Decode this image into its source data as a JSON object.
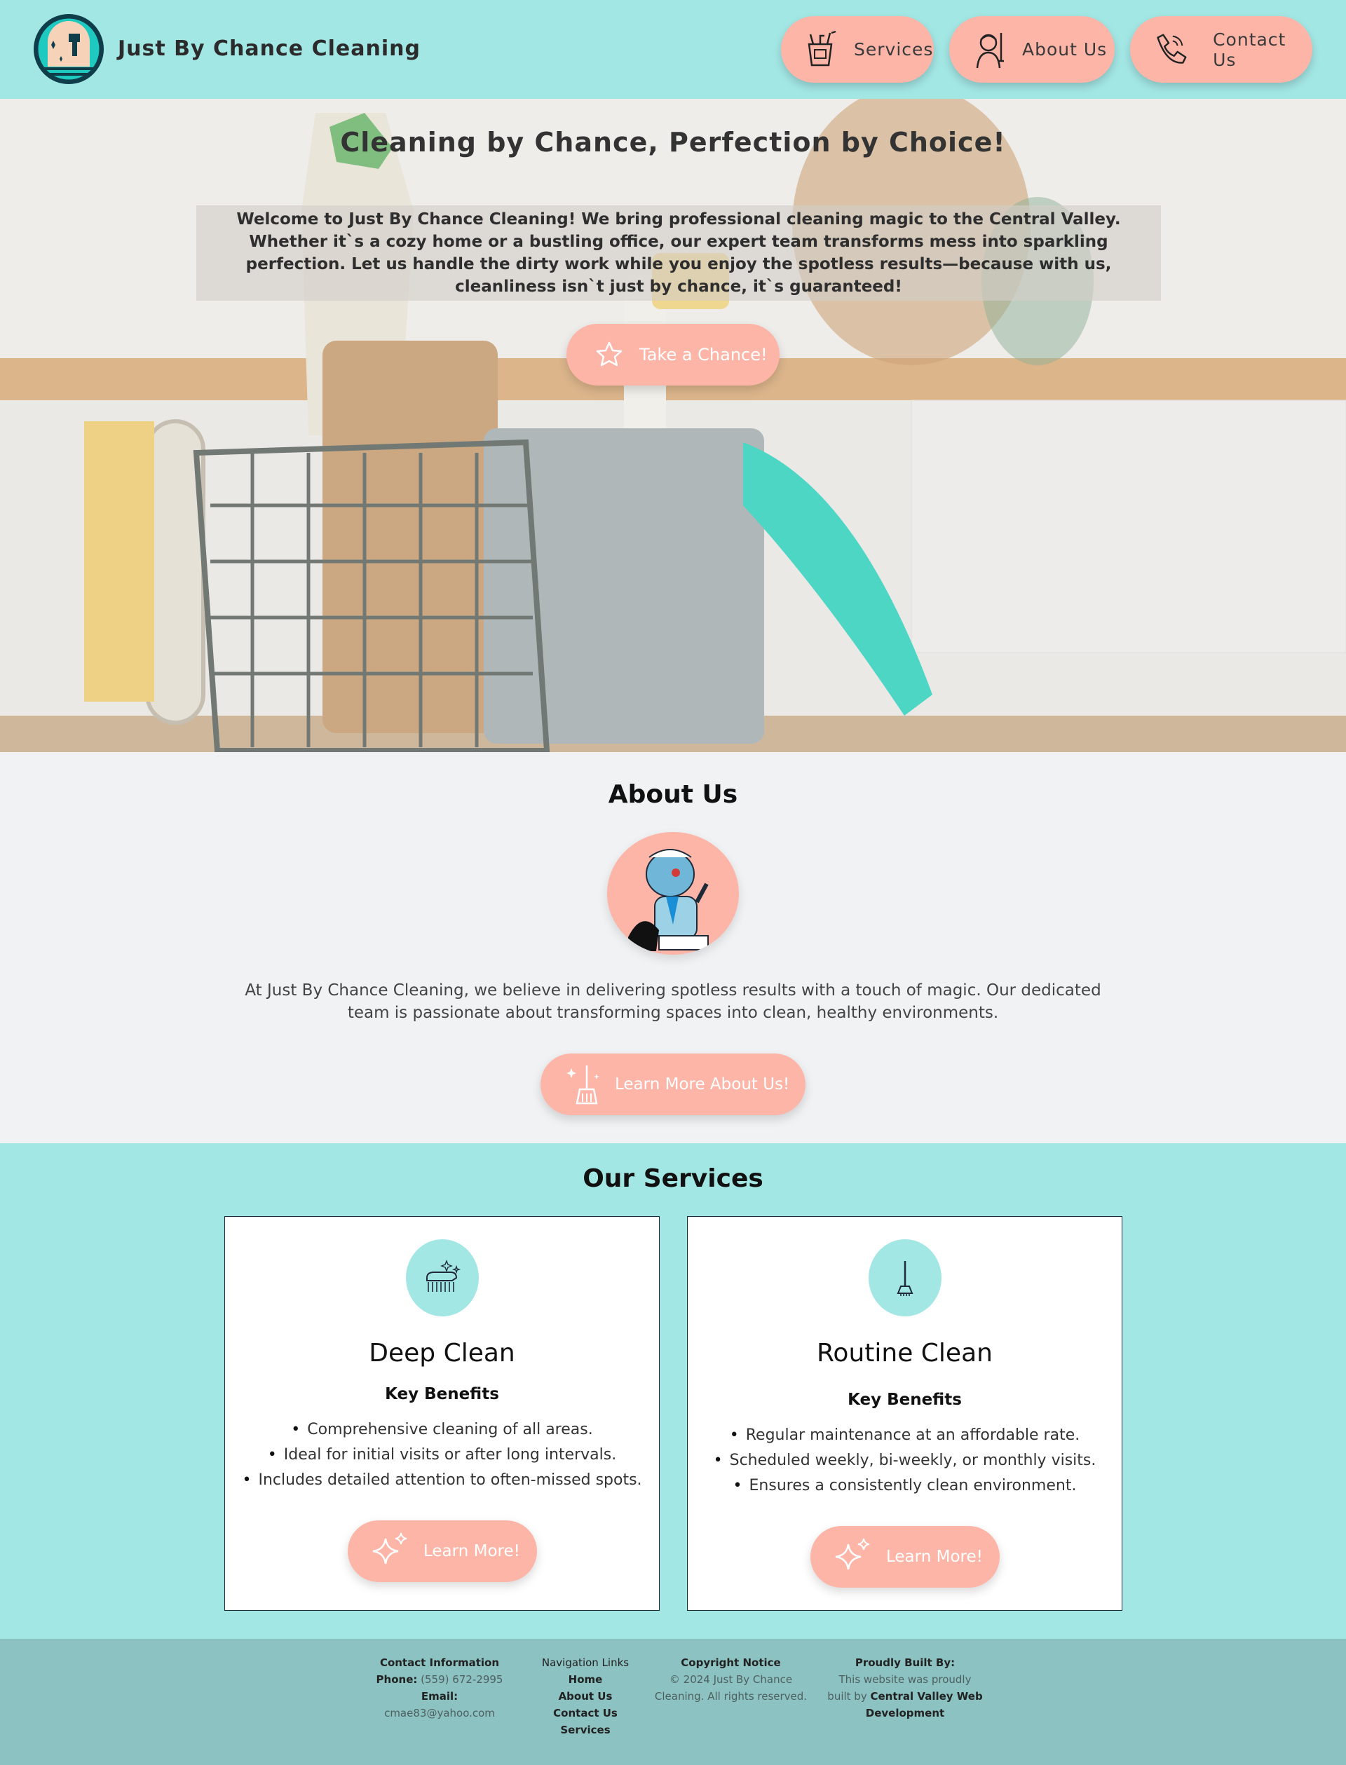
{
  "header": {
    "brand": "Just By Chance Cleaning",
    "nav": [
      {
        "label": "Services",
        "icon": "cleaning-bucket-icon"
      },
      {
        "label": "About Us",
        "icon": "maid-icon"
      },
      {
        "label": "Contact Us",
        "icon": "phone-icon"
      }
    ]
  },
  "hero": {
    "title": "Cleaning by Chance, Perfection by Choice!",
    "text": "Welcome to Just By Chance Cleaning! We bring professional cleaning magic to the Central Valley. Whether it`s a cozy home or a bustling office, our expert team transforms mess into sparkling perfection. Let us handle the dirty work while you enjoy the spotless results—because with us, cleanliness isn`t just by chance, it`s guaranteed!",
    "button": "Take a Chance!"
  },
  "about": {
    "title": "About Us",
    "text": "At Just By Chance Cleaning, we believe in delivering spotless results with a touch of magic. Our dedicated team is passionate about transforming spaces into clean, healthy environments.",
    "button": "Learn More About Us!"
  },
  "services": {
    "title": "Our Services",
    "cards": [
      {
        "title": "Deep Clean",
        "subtitle": "Key Benefits",
        "items": [
          "Comprehensive cleaning of all areas.",
          "Ideal for initial visits or after long intervals.",
          "Includes detailed attention to often-missed spots."
        ],
        "button": "Learn More!"
      },
      {
        "title": "Routine Clean",
        "subtitle": "Key Benefits",
        "items": [
          "Regular maintenance at an affordable rate.",
          "Scheduled weekly, bi-weekly, or monthly visits.",
          "Ensures a consistently clean environment."
        ],
        "button": "Learn More!"
      }
    ]
  },
  "footer": {
    "contact": {
      "heading": "Contact Information",
      "phone_label": "Phone:",
      "phone": "(559) 672-2995",
      "email_label": "Email:",
      "email": "cmae83@yahoo.com"
    },
    "navigation": {
      "heading": "Navigation Links",
      "links": [
        "Home",
        "About Us",
        "Contact Us",
        "Services"
      ]
    },
    "copyright": {
      "heading": "Copyright Notice",
      "line1": "© 2024 Just By Chance",
      "line2": "Cleaning. All rights reserved."
    },
    "built": {
      "heading": "Proudly Built By:",
      "line1": "This website was proudly",
      "line2_prefix": "built by",
      "builder1": "Central Valley Web",
      "builder2": "Development"
    }
  },
  "colors": {
    "teal": "#a3e7e5",
    "salmon": "#fdb5a8",
    "footer": "#8cc2c1",
    "about_bg": "#f1f2f4"
  }
}
